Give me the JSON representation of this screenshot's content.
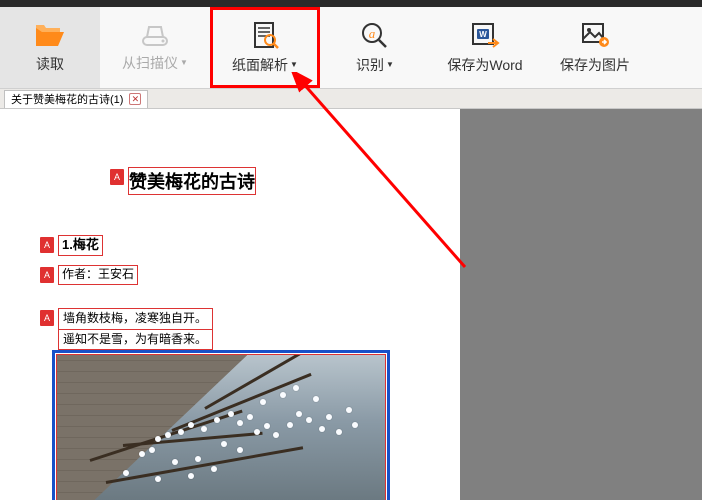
{
  "toolbar": {
    "read": "读取",
    "from_scanner": "从扫描仪",
    "page_analysis": "纸面解析",
    "recognize": "识别",
    "save_word": "保存为Word",
    "save_image": "保存为图片"
  },
  "tab": {
    "title": "关于赞美梅花的古诗(1)"
  },
  "document": {
    "title": "赞美梅花的古诗",
    "section_heading": "1.梅花",
    "author_line": "作者：王安石",
    "poem_line1": "墙角数枝梅，凌寒独自开。",
    "poem_line2": "遥知不是雪，为有暗香来。"
  },
  "badge": "A"
}
